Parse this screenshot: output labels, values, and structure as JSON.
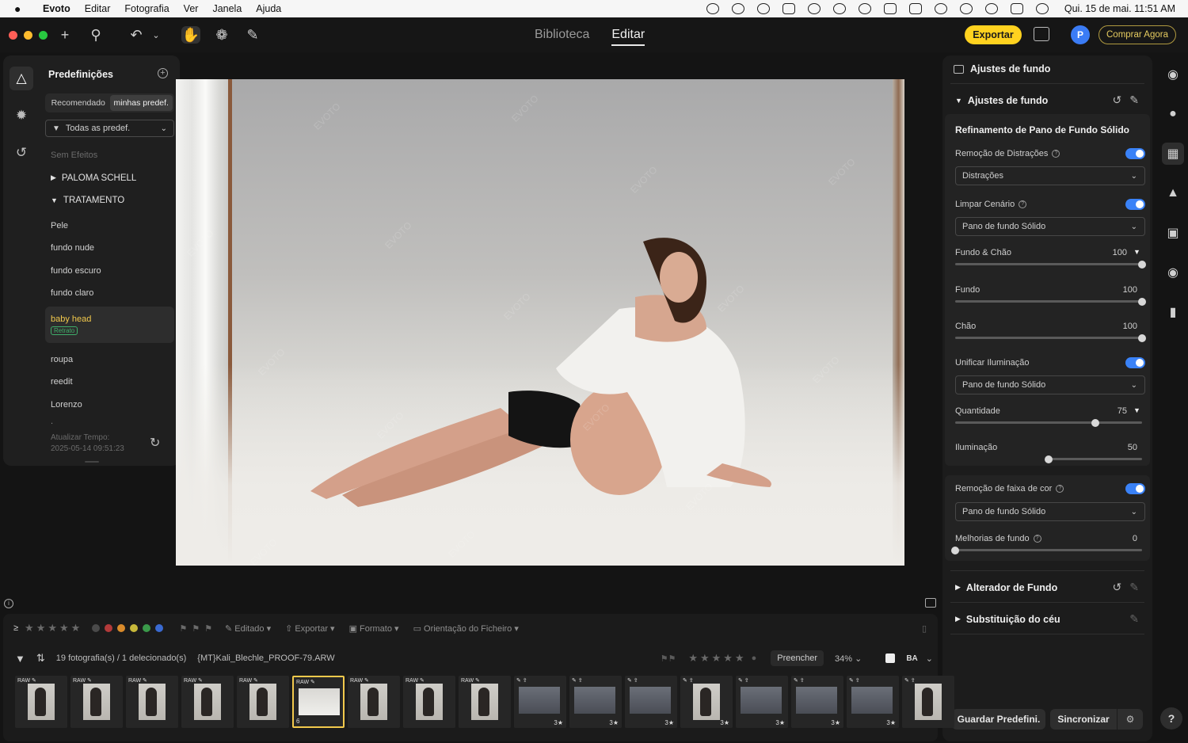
{
  "menubar": {
    "apple": "",
    "items": [
      "Evoto",
      "Editar",
      "Fotografia",
      "Ver",
      "Janela",
      "Ajuda"
    ],
    "clock": "Qui. 15 de mai.  11:51 AM"
  },
  "toolbar": {
    "tabs": [
      "Biblioteca",
      "Editar"
    ],
    "active_tab": "Editar",
    "export_label": "Exportar",
    "avatar_initial": "P",
    "buy_label": "Comprar Agora"
  },
  "presets": {
    "title": "Predefinições",
    "segments": [
      "Recomendado",
      "minhas predef."
    ],
    "filter": "Todas as predef.",
    "items": [
      {
        "label": "Sem Efeitos",
        "kind": "muted"
      },
      {
        "label": "PALOMA SCHELL",
        "kind": "folder-closed"
      },
      {
        "label": "TRATAMENTO",
        "kind": "folder-open"
      },
      {
        "label": "Pele",
        "kind": "item"
      },
      {
        "label": "fundo nude",
        "kind": "item"
      },
      {
        "label": "fundo escuro",
        "kind": "item"
      },
      {
        "label": "fundo claro",
        "kind": "item"
      },
      {
        "label": "baby head",
        "kind": "selected",
        "badge": "Retrato"
      },
      {
        "label": "roupa",
        "kind": "item"
      },
      {
        "label": "reedit",
        "kind": "item"
      },
      {
        "label": "Lorenzo",
        "kind": "item"
      },
      {
        "label": ".",
        "kind": "dot"
      }
    ],
    "update_label": "Atualizar Tempo:",
    "update_time": "2025-05-14 09:51:23"
  },
  "right_panel": {
    "header": "Ajustes de fundo",
    "section1": "Ajustes de fundo",
    "card_title": "Refinamento de Pano de Fundo Sólido",
    "distraction_label": "Remoção de Distrações",
    "distraction_select": "Distrações",
    "clean_label": "Limpar Cenário",
    "clean_select": "Pano de fundo Sólido",
    "bgfloor_label": "Fundo & Chão",
    "bgfloor_value": "100",
    "bg_label": "Fundo",
    "bg_value": "100",
    "floor_label": "Chão",
    "floor_value": "100",
    "unify_label": "Unificar Iluminação",
    "unify_select": "Pano de fundo Sólido",
    "qty_label": "Quantidade",
    "qty_value": "75",
    "light_label": "Iluminação",
    "light_value": "50",
    "band_label": "Remoção de faixa de cor",
    "band_select": "Pano de fundo Sólido",
    "improve_label": "Melhorias de fundo",
    "improve_value": "0",
    "section2": "Alterador de Fundo",
    "section3": "Substituição do céu",
    "save_btn": "Guardar Predefini.",
    "sync_btn": "Sincronizar",
    "help": "?",
    "sliders": {
      "bgfloor": 1.0,
      "bg": 1.0,
      "floor": 1.0,
      "qty": 0.75,
      "light": 0.5,
      "improve": 0.0
    }
  },
  "bottom": {
    "edited": "Editado",
    "export": "Exportar",
    "format": "Formato",
    "orientation": "Orientação do Ficheiro",
    "count": "19 fotografia(s) / 1 delecionado(s)",
    "filename": "{MT}Kali_Blechle_PROOF-79.ARW",
    "fill": "Preencher",
    "zoom": "34%",
    "label_colors": [
      "#4a4a4a",
      "#b33a3a",
      "#d98b2b",
      "#c7b83a",
      "#3a9a4a",
      "#3a6ad1"
    ],
    "thumbs": [
      {
        "tag": "RAW",
        "kind": "portrait"
      },
      {
        "tag": "RAW",
        "kind": "portrait"
      },
      {
        "tag": "RAW",
        "kind": "portrait"
      },
      {
        "tag": "RAW",
        "kind": "portrait"
      },
      {
        "tag": "RAW",
        "kind": "portrait"
      },
      {
        "tag": "RAW",
        "kind": "wide",
        "selected": true,
        "num": "6"
      },
      {
        "tag": "RAW",
        "kind": "portrait"
      },
      {
        "tag": "RAW",
        "kind": "portrait"
      },
      {
        "tag": "RAW",
        "kind": "portrait"
      },
      {
        "tag": "",
        "kind": "wide",
        "rate": "3★"
      },
      {
        "tag": "",
        "kind": "wide",
        "rate": "3★"
      },
      {
        "tag": "",
        "kind": "wide",
        "rate": "3★"
      },
      {
        "tag": "",
        "kind": "portrait",
        "rate": "3★"
      },
      {
        "tag": "",
        "kind": "wide",
        "rate": "3★"
      },
      {
        "tag": "",
        "kind": "wide",
        "rate": "3★"
      },
      {
        "tag": "",
        "kind": "wide",
        "rate": "3★"
      },
      {
        "tag": "",
        "kind": "portrait"
      }
    ]
  }
}
